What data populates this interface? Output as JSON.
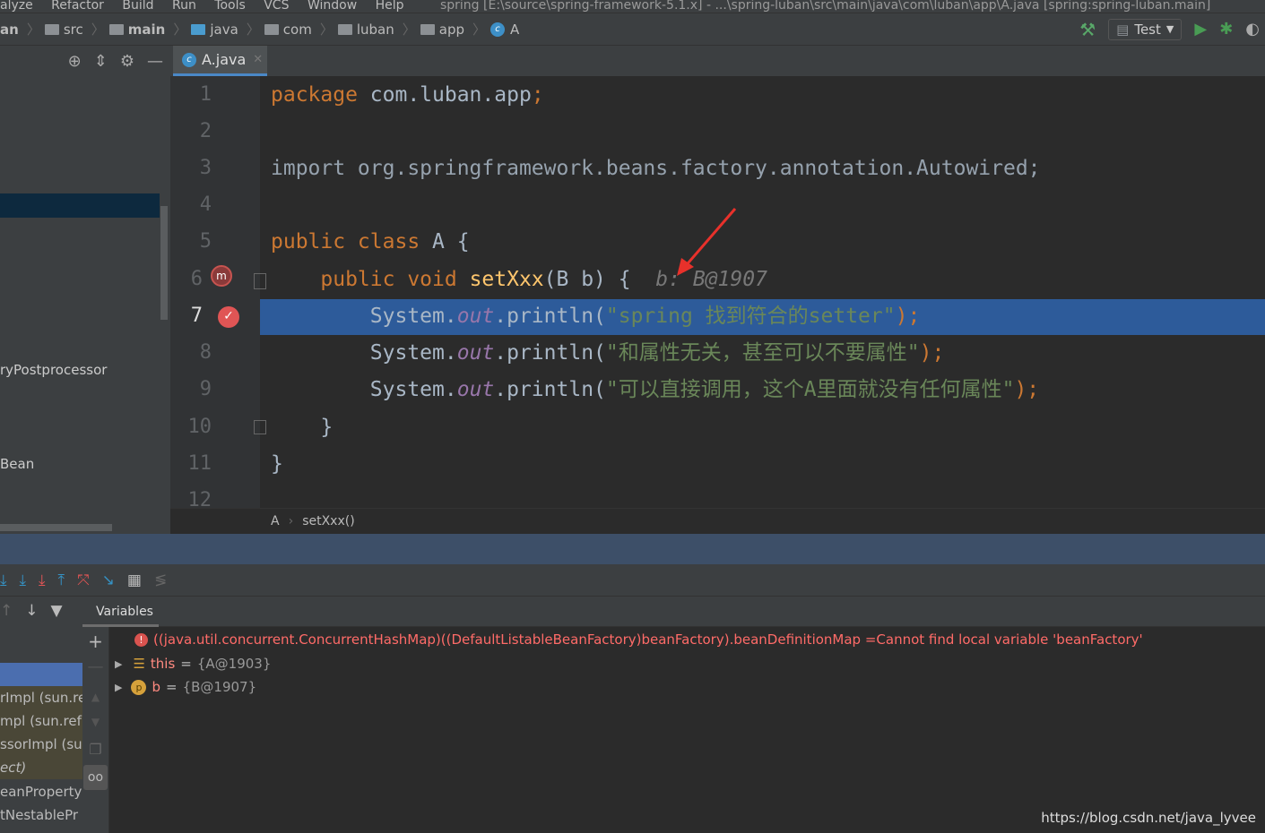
{
  "menu": {
    "items": [
      "alyze",
      "Refactor",
      "Build",
      "Run",
      "Tools",
      "VCS",
      "Window",
      "Help"
    ],
    "title": "spring [E:\\source\\spring-framework-5.1.x] - ...\\spring-luban\\src\\main\\java\\com\\luban\\app\\A.java [spring:spring-luban.main]"
  },
  "breadcrumb": [
    "an",
    "src",
    "main",
    "java",
    "com",
    "luban",
    "app",
    "A"
  ],
  "run_config": "Test",
  "editor": {
    "tab": "A.java",
    "lines": [
      "1",
      "2",
      "3",
      "4",
      "5",
      "6",
      "7",
      "8",
      "9",
      "10",
      "11",
      "12"
    ],
    "code": {
      "l1_kw": "package",
      "l1_rest": " com.luban.app",
      "l1_semi": ";",
      "l3": "import org.springframework.beans.factory.annotation.Autowired;",
      "l5_kw": "public class",
      "l5_rest": " A {",
      "l6_kw": "    public void ",
      "l6_fn": "setXxx",
      "l6_rest": "(B b) {",
      "l6_hint": "  b: B@1907",
      "l7_a": "        System.",
      "l7_out": "out",
      "l7_b": ".println(",
      "l7_str": "\"spring 找到符合的setter\"",
      "l7_c": ");",
      "l8_str": "\"和属性无关，甚至可以不要属性\"",
      "l9_str": "\"可以直接调用，这个A里面就没有任何属性\"",
      "sys": "        System.",
      "out": "out",
      "println": ".println(",
      "end": ");",
      "l10": "    }",
      "l11": "}"
    },
    "breadcrumb": [
      "A",
      "setXxx()"
    ]
  },
  "sidebar": {
    "items": [
      "ryPostprocessor",
      "Bean"
    ]
  },
  "debugger": {
    "variables_tab": "Variables",
    "frames": [
      "rImpl (sun.re",
      "mpl (sun.ref",
      "ssorImpl (su",
      "ect)",
      "eanPropertyI",
      "tNestablePr"
    ],
    "error": {
      "expr": "((java.util.concurrent.ConcurrentHashMap)((DefaultListableBeanFactory)beanFactory).beanDefinitionMap = ",
      "msg": "Cannot find local variable 'beanFactory'"
    },
    "vars": [
      {
        "name": "this",
        "value": "{A@1903}"
      },
      {
        "name": "b",
        "value": "{B@1907}"
      }
    ]
  },
  "watermark": "https://blog.csdn.net/java_lyvee",
  "colors": {
    "keyword": "#cc7832",
    "string": "#6a8759",
    "exec_line": "#2d5b9a",
    "error": "#ff6b68"
  }
}
